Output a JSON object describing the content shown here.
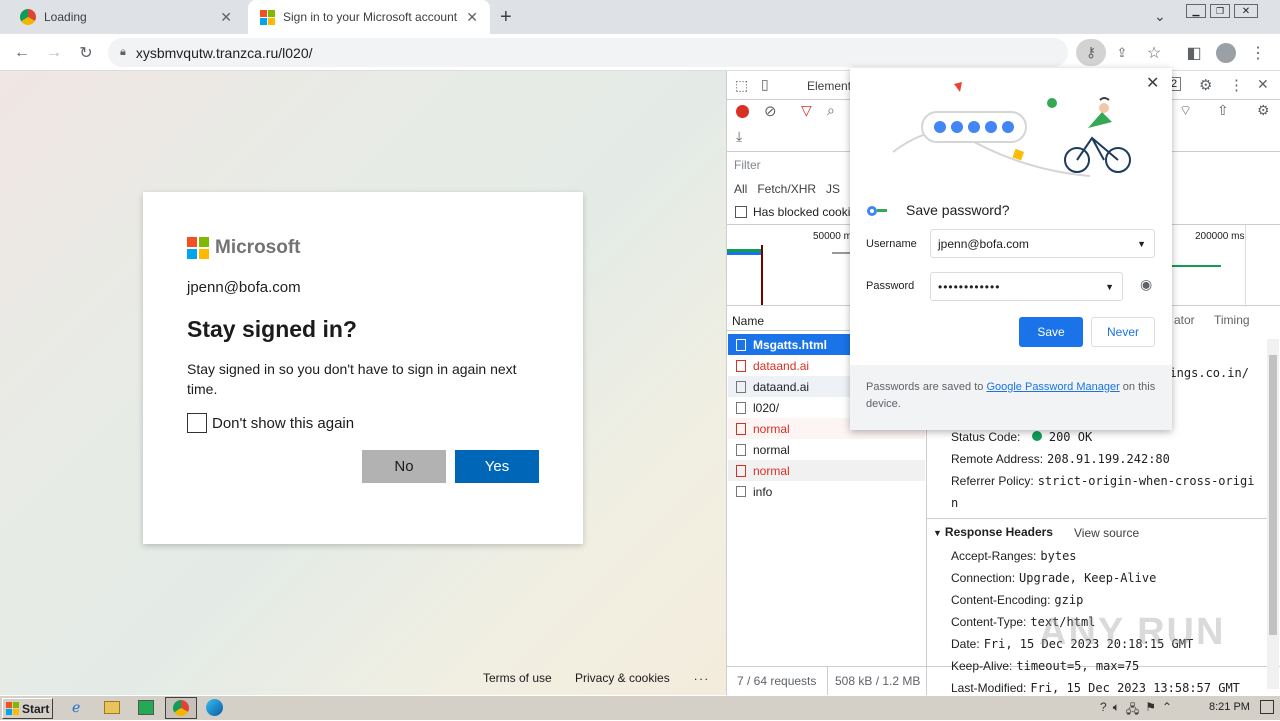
{
  "browser": {
    "tabs": [
      {
        "title": "Loading",
        "active": false
      },
      {
        "title": "Sign in to your Microsoft account",
        "active": true
      }
    ],
    "new_tab": "+",
    "url": "xysbmvqutw.tranzca.ru/l020/"
  },
  "signin": {
    "brand": "Microsoft",
    "email": "jpenn@bofa.com",
    "heading": "Stay signed in?",
    "body": "Stay signed in so you don't have to sign in again next time.",
    "checkbox_label": "Don't show this again",
    "no_label": "No",
    "yes_label": "Yes",
    "footer": {
      "terms": "Terms of use",
      "privacy": "Privacy & cookies",
      "more": "..."
    }
  },
  "devtools": {
    "tab_elements": "Element",
    "tab_count": "2",
    "filter_placeholder": "Filter",
    "filter_types": [
      "All",
      "Fetch/XHR",
      "JS",
      "C"
    ],
    "blocked_label": "Has blocked cooki",
    "timeline_ticks": [
      "50000 m",
      "200000 ms"
    ],
    "col_name": "Name",
    "side_tabs": [
      "ator",
      "Timing"
    ],
    "requests": [
      {
        "name": "Msgatts.html",
        "color": "#ffffff",
        "selected": true
      },
      {
        "name": "dataand.ai",
        "color": "#d93025",
        "selected": false
      },
      {
        "name": "dataand.ai",
        "color": "#202124",
        "selected": false
      },
      {
        "name": "l020/",
        "color": "#202124",
        "selected": false
      },
      {
        "name": "normal",
        "color": "#d93025",
        "selected": false
      },
      {
        "name": "normal",
        "color": "#202124",
        "selected": false
      },
      {
        "name": "normal",
        "color": "#d93025",
        "selected": false
      },
      {
        "name": "info",
        "color": "#202124",
        "selected": false
      }
    ],
    "url_fragment": "shings.co.in/",
    "general": {
      "status_label": "Status Code:",
      "status_value": "200 OK",
      "remote_label": "Remote Address:",
      "remote_value": "208.91.199.242:80",
      "referrer_label": "Referrer Policy:",
      "referrer_value": "strict-origin-when-cross-origi",
      "referrer_value2": "n"
    },
    "response_headers_title": "Response Headers",
    "view_source": "View source",
    "headers": [
      {
        "k": "Accept-Ranges:",
        "v": "bytes"
      },
      {
        "k": "Connection:",
        "v": "Upgrade, Keep-Alive"
      },
      {
        "k": "Content-Encoding:",
        "v": "gzip"
      },
      {
        "k": "Content-Type:",
        "v": "text/html"
      },
      {
        "k": "Date:",
        "v": "Fri, 15 Dec 2023 20:18:15 GMT"
      },
      {
        "k": "Keep-Alive:",
        "v": "timeout=5, max=75"
      },
      {
        "k": "Last-Modified:",
        "v": "Fri, 15 Dec 2023 13:58:57 GMT"
      }
    ],
    "status_bar": {
      "requests": "7 / 64 requests",
      "size": "508 kB / 1.2 MB"
    }
  },
  "save_password": {
    "title": "Save password?",
    "username_label": "Username",
    "username_value": "jpenn@bofa.com",
    "password_label": "Password",
    "password_value": "••••••••••••",
    "save_label": "Save",
    "never_label": "Never",
    "footer_prefix": "Passwords are saved to ",
    "footer_link": "Google Password Manager",
    "footer_suffix": " on this device."
  },
  "taskbar": {
    "start_label": "Start",
    "clock": "8:21 PM"
  },
  "watermark": "ANY RUN",
  "colors": {
    "ms_blue": "#0067b8",
    "chrome_blue": "#1a73e8",
    "error_red": "#d93025"
  }
}
